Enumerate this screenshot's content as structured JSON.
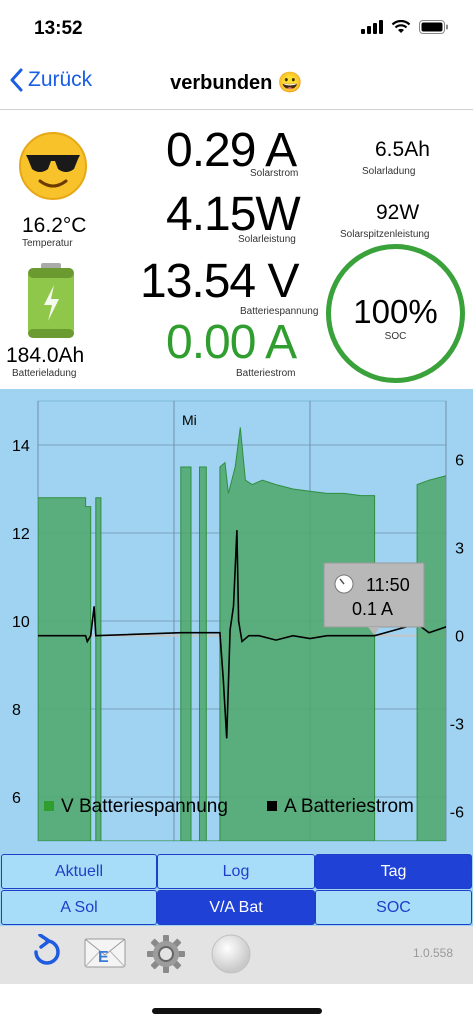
{
  "status": {
    "time": "13:52"
  },
  "nav": {
    "back_label": "Zurück",
    "title": "verbunden 😀"
  },
  "stats": {
    "temp_value": "16.2°C",
    "temp_label": "Temperatur",
    "battery_charge_value": "184.0Ah",
    "battery_charge_label": "Batterieladung",
    "solar_current_value": "0.29 A",
    "solar_current_label": "Solarstrom",
    "solar_power_value": "4.15W",
    "solar_power_label": "Solarleistung",
    "battery_voltage_value": "13.54 V",
    "battery_voltage_label": "Batteriespannung",
    "battery_current_value": "0.00 A",
    "battery_current_label": "Batteriestrom",
    "solar_charge_value": "6.5Ah",
    "solar_charge_label": "Solarladung",
    "solar_peak_value": "92W",
    "solar_peak_label": "Solarspitzenleistung",
    "soc_value": "100%",
    "soc_label": "SOC",
    "soc_fraction": 1.0,
    "colors": {
      "green": "#2f9e2f",
      "gauge": "#3aa23a"
    }
  },
  "chart_data": {
    "type": "line",
    "day_label": "Mi",
    "left_axis": {
      "ticks": [
        "14",
        "12",
        "10",
        "8",
        "6"
      ],
      "ylim": [
        5,
        15
      ]
    },
    "right_axis": {
      "ticks": [
        "6",
        "3",
        "0",
        "-3",
        "-6"
      ],
      "ylim": [
        -7,
        8
      ]
    },
    "x_hours": [
      0,
      24
    ],
    "tooltip": {
      "time": "11:50",
      "value": "0.1 A"
    },
    "series": [
      {
        "name": "V Batteriespannung",
        "color": "#2f9e2f",
        "points": [
          [
            0,
            12.8
          ],
          [
            2.8,
            12.8
          ],
          [
            2.8,
            12.6
          ],
          [
            3.1,
            12.6
          ],
          [
            3.1,
            5
          ],
          [
            3.4,
            5
          ],
          [
            3.4,
            12.8
          ],
          [
            3.7,
            12.8
          ],
          [
            3.7,
            5
          ],
          [
            8.4,
            5
          ],
          [
            8.4,
            13.5
          ],
          [
            9.0,
            13.5
          ],
          [
            9.0,
            5
          ],
          [
            9.5,
            5
          ],
          [
            9.5,
            13.5
          ],
          [
            9.9,
            13.5
          ],
          [
            9.9,
            5
          ],
          [
            10.7,
            5
          ],
          [
            10.7,
            13.5
          ],
          [
            11.0,
            13.6
          ],
          [
            11.2,
            12.9
          ],
          [
            11.6,
            13.5
          ],
          [
            11.9,
            14.4
          ],
          [
            12.2,
            13.2
          ],
          [
            12.6,
            13.1
          ],
          [
            13.2,
            13.2
          ],
          [
            14,
            13.1
          ],
          [
            15,
            13.0
          ],
          [
            16,
            12.95
          ],
          [
            17,
            12.9
          ],
          [
            18,
            12.9
          ],
          [
            19,
            12.85
          ],
          [
            19.8,
            12.85
          ],
          [
            19.8,
            5
          ],
          [
            22.3,
            5
          ],
          [
            22.3,
            13.1
          ],
          [
            23,
            13.2
          ],
          [
            24,
            13.3
          ],
          [
            25,
            13.3
          ],
          [
            26,
            13.4
          ],
          [
            26.5,
            13.2
          ],
          [
            27.6,
            13.1
          ],
          [
            27.6,
            5
          ]
        ]
      },
      {
        "name": "A Batteriestrom",
        "color": "#000000",
        "points": [
          [
            0,
            0
          ],
          [
            2.8,
            0
          ],
          [
            2.9,
            -0.2
          ],
          [
            3.1,
            0
          ],
          [
            3.3,
            1
          ],
          [
            3.4,
            0
          ],
          [
            8.4,
            0.1
          ],
          [
            9.0,
            0.1
          ],
          [
            9.5,
            0.1
          ],
          [
            9.9,
            0.1
          ],
          [
            10.7,
            0.1
          ],
          [
            10.9,
            -1.5
          ],
          [
            11.1,
            -3.5
          ],
          [
            11.3,
            0.2
          ],
          [
            11.5,
            1
          ],
          [
            11.7,
            3.6
          ],
          [
            11.8,
            0.5
          ],
          [
            12.0,
            -0.2
          ],
          [
            12.4,
            0
          ],
          [
            13,
            0
          ],
          [
            14,
            -0.15
          ],
          [
            15,
            0
          ],
          [
            16,
            -0.1
          ],
          [
            17,
            0
          ],
          [
            18,
            0
          ],
          [
            19,
            0
          ],
          [
            19.8,
            0
          ],
          [
            22.3,
            0.4
          ],
          [
            23,
            0.1
          ],
          [
            24,
            0.3
          ],
          [
            25,
            0.8
          ],
          [
            25.5,
            0.2
          ],
          [
            26,
            1
          ],
          [
            26.5,
            0.4
          ],
          [
            27,
            0.1
          ],
          [
            27.6,
            0
          ]
        ]
      }
    ]
  },
  "buttons": {
    "row1": [
      "Aktuell",
      "Log",
      "Tag"
    ],
    "row2": [
      "A Sol",
      "V/A Bat",
      "SOC"
    ]
  },
  "toolbar": {
    "version": "1.0.558"
  }
}
